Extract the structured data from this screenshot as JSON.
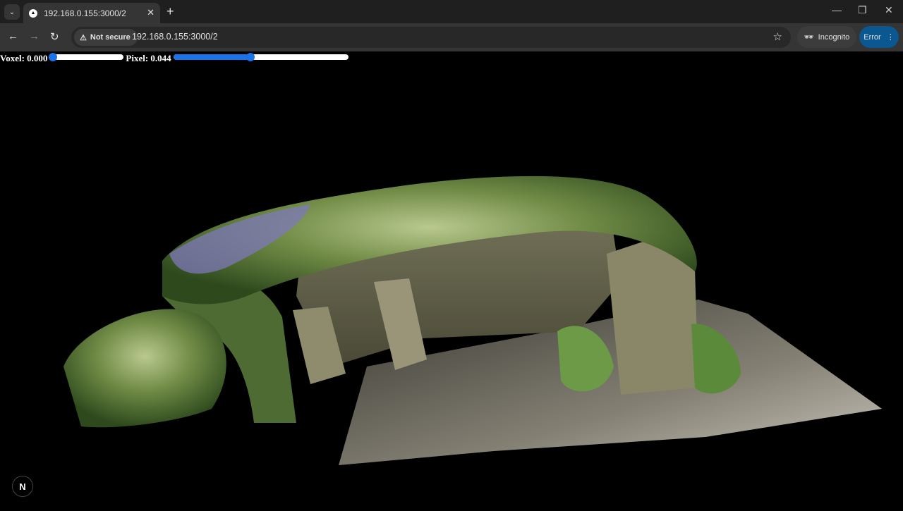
{
  "browser": {
    "tab": {
      "title": "192.168.0.155:3000/2"
    },
    "address": {
      "security": "Not secure",
      "url": "192.168.0.155:3000/2"
    },
    "profile": "Incognito",
    "status": "Error"
  },
  "controls": {
    "voxel": {
      "label": "Voxel: 0.000",
      "fraction": 0.0
    },
    "pixel": {
      "label": "Pixel: 0.044",
      "fraction": 0.44
    }
  },
  "icons": [
    "tab-search-icon",
    "favicon-icon",
    "close-icon",
    "plus-icon",
    "minimize-icon",
    "restore-icon",
    "window-close-icon",
    "back-icon",
    "forward-icon",
    "reload-icon",
    "warning-icon",
    "star-icon",
    "incognito-icon",
    "more-icon",
    "next-logo-icon"
  ],
  "badge": {
    "letter": "N"
  }
}
